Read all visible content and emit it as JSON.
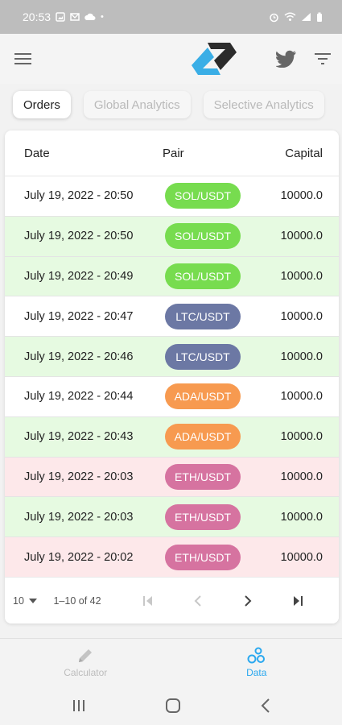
{
  "status_bar": {
    "time": "20:53",
    "left_icons": [
      "gallery-icon",
      "mail-icon",
      "cloud-icon",
      "dot-icon"
    ],
    "right_icons": [
      "alarm-icon",
      "wifi-icon",
      "signal-icon",
      "battery-icon"
    ]
  },
  "app_bar": {
    "left_icon": "menu-icon",
    "logo": "app-logo",
    "right_icons": [
      "twitter-icon",
      "filter-icon"
    ]
  },
  "tabs": [
    {
      "label": "Orders",
      "active": true
    },
    {
      "label": "Global Analytics",
      "active": false
    },
    {
      "label": "Selective Analytics",
      "active": false
    }
  ],
  "table": {
    "headers": {
      "date": "Date",
      "pair": "Pair",
      "capital": "Capital"
    },
    "rows": [
      {
        "date": "July 19, 2022 - 20:50",
        "pair": "SOL/USDT",
        "capital": "10000.0",
        "row_tone": "white",
        "pill_color": "#77dc4f"
      },
      {
        "date": "July 19, 2022 - 20:50",
        "pair": "SOL/USDT",
        "capital": "10000.0",
        "row_tone": "green",
        "pill_color": "#77dc4f"
      },
      {
        "date": "July 19, 2022 - 20:49",
        "pair": "SOL/USDT",
        "capital": "10000.0",
        "row_tone": "green",
        "pill_color": "#77dc4f"
      },
      {
        "date": "July 19, 2022 - 20:47",
        "pair": "LTC/USDT",
        "capital": "10000.0",
        "row_tone": "white",
        "pill_color": "#6c78a4"
      },
      {
        "date": "July 19, 2022 - 20:46",
        "pair": "LTC/USDT",
        "capital": "10000.0",
        "row_tone": "green",
        "pill_color": "#6c78a4"
      },
      {
        "date": "July 19, 2022 - 20:44",
        "pair": "ADA/USDT",
        "capital": "10000.0",
        "row_tone": "white",
        "pill_color": "#f79a50"
      },
      {
        "date": "July 19, 2022 - 20:43",
        "pair": "ADA/USDT",
        "capital": "10000.0",
        "row_tone": "green",
        "pill_color": "#f79a50"
      },
      {
        "date": "July 19, 2022 - 20:03",
        "pair": "ETH/USDT",
        "capital": "10000.0",
        "row_tone": "red",
        "pill_color": "#d673a0"
      },
      {
        "date": "July 19, 2022 - 20:03",
        "pair": "ETH/USDT",
        "capital": "10000.0",
        "row_tone": "green",
        "pill_color": "#d673a0"
      },
      {
        "date": "July 19, 2022 - 20:02",
        "pair": "ETH/USDT",
        "capital": "10000.0",
        "row_tone": "red",
        "pill_color": "#d673a0"
      }
    ]
  },
  "pagination": {
    "rows_per_page": "10",
    "range": "1–10 of 42",
    "first_icon": "first-page-icon",
    "prev_icon": "prev-page-icon",
    "next_icon": "next-page-icon",
    "last_icon": "last-page-icon"
  },
  "bottom_nav": [
    {
      "label": "Calculator",
      "icon": "pencil-icon",
      "active": false
    },
    {
      "label": "Data",
      "icon": "data-bubbles-icon",
      "active": true
    }
  ],
  "system_nav": [
    "recents-icon",
    "home-icon",
    "back-icon"
  ],
  "colors": {
    "accent": "#2aa8ef",
    "logo_dark": "#2b2b2b",
    "logo_blue": "#3aaee6",
    "row_green": "#e6fae1",
    "row_red": "#fde8ea"
  }
}
